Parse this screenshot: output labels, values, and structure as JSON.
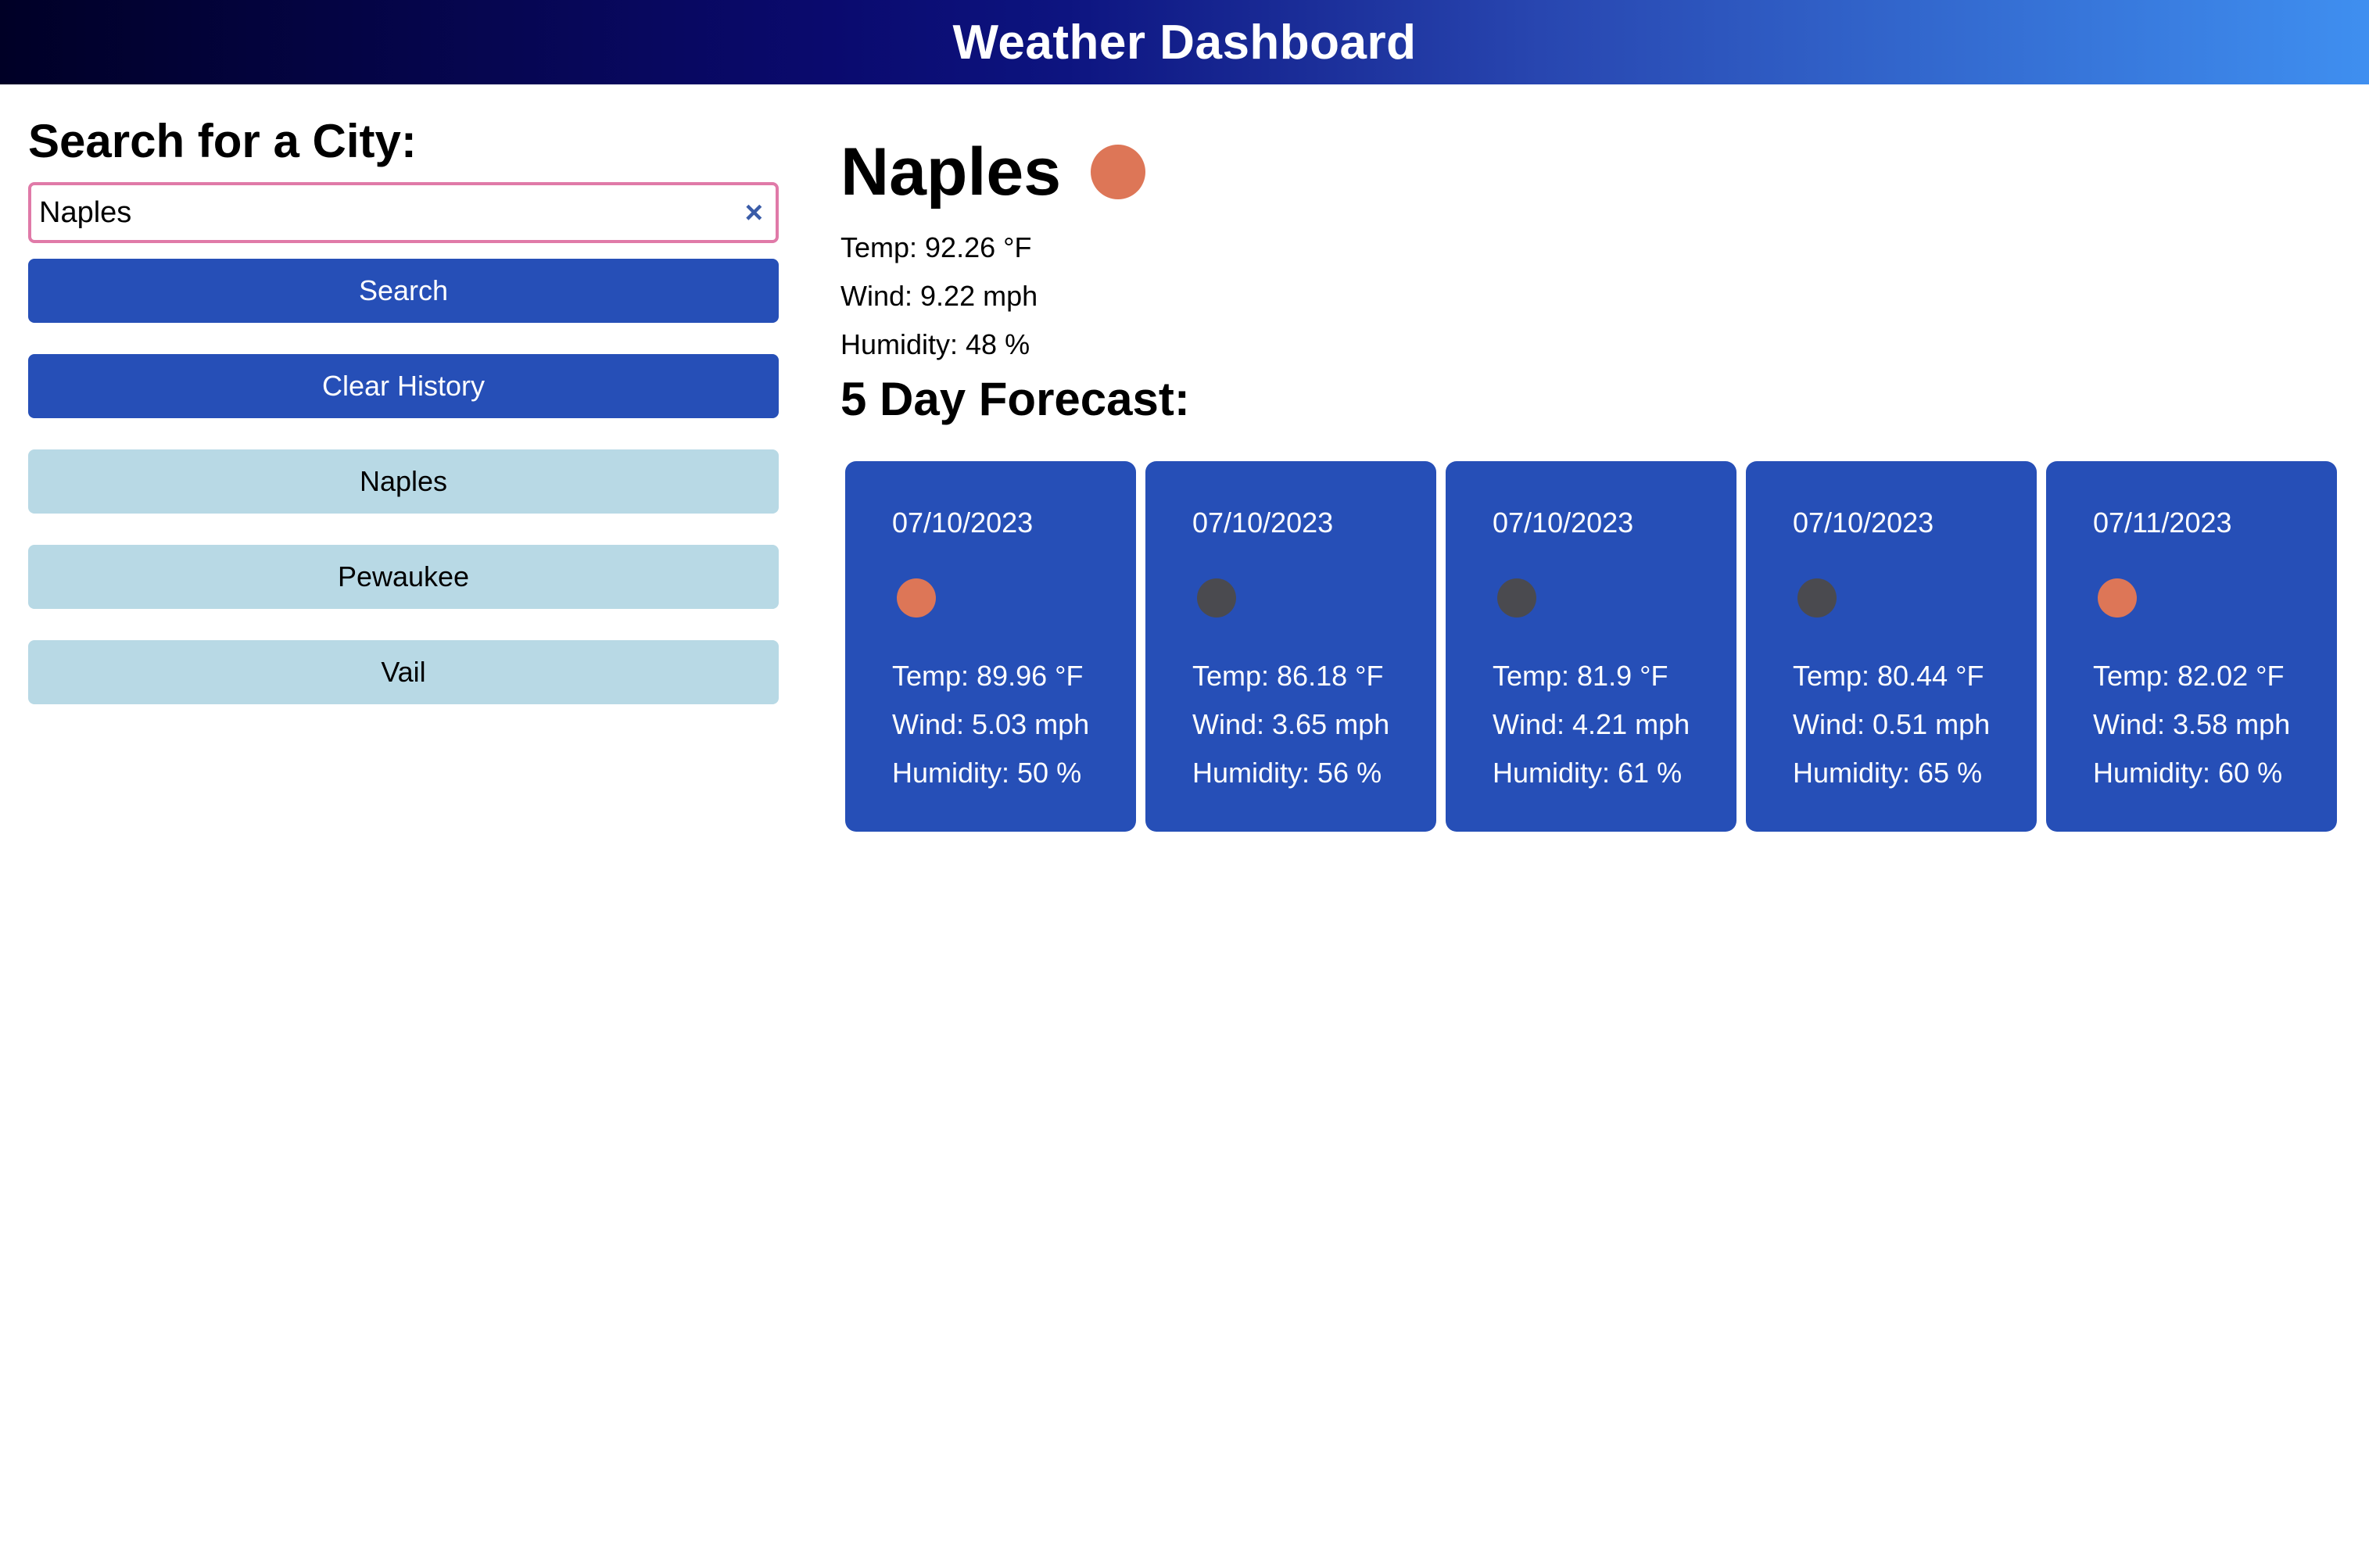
{
  "header": {
    "title": "Weather Dashboard"
  },
  "search": {
    "heading": "Search for a City:",
    "value": "Naples",
    "clear_glyph": "×",
    "search_label": "Search",
    "clear_history_label": "Clear History"
  },
  "history": [
    "Naples",
    "Pewaukee",
    "Vail"
  ],
  "current": {
    "city": "Naples",
    "icon": "sun-icon",
    "temp": "Temp: 92.26 °F",
    "wind": "Wind: 9.22 mph",
    "humidity": "Humidity: 48 %"
  },
  "forecast": {
    "heading": "5 Day Forecast:",
    "days": [
      {
        "date": "07/10/2023",
        "icon": "sun-icon",
        "icon_color": "#dd7657",
        "temp": "Temp: 89.96 °F",
        "wind": "Wind: 5.03 mph",
        "humidity": "Humidity: 50 %"
      },
      {
        "date": "07/10/2023",
        "icon": "moon-icon",
        "icon_color": "#4a4a4f",
        "temp": "Temp: 86.18 °F",
        "wind": "Wind: 3.65 mph",
        "humidity": "Humidity: 56 %"
      },
      {
        "date": "07/10/2023",
        "icon": "moon-icon",
        "icon_color": "#4a4a4f",
        "temp": "Temp: 81.9 °F",
        "wind": "Wind: 4.21 mph",
        "humidity": "Humidity: 61 %"
      },
      {
        "date": "07/10/2023",
        "icon": "moon-icon",
        "icon_color": "#4a4a4f",
        "temp": "Temp: 80.44 °F",
        "wind": "Wind: 0.51 mph",
        "humidity": "Humidity: 65 %"
      },
      {
        "date": "07/11/2023",
        "icon": "sun-icon",
        "icon_color": "#dd7657",
        "temp": "Temp: 82.02 °F",
        "wind": "Wind: 3.58 mph",
        "humidity": "Humidity: 60 %"
      }
    ]
  },
  "colors": {
    "primary_button": "#264fb7",
    "history_button": "#b8d9e5",
    "input_border": "#e07aa8",
    "sun": "#dd7657",
    "moon": "#4a4a4f"
  }
}
